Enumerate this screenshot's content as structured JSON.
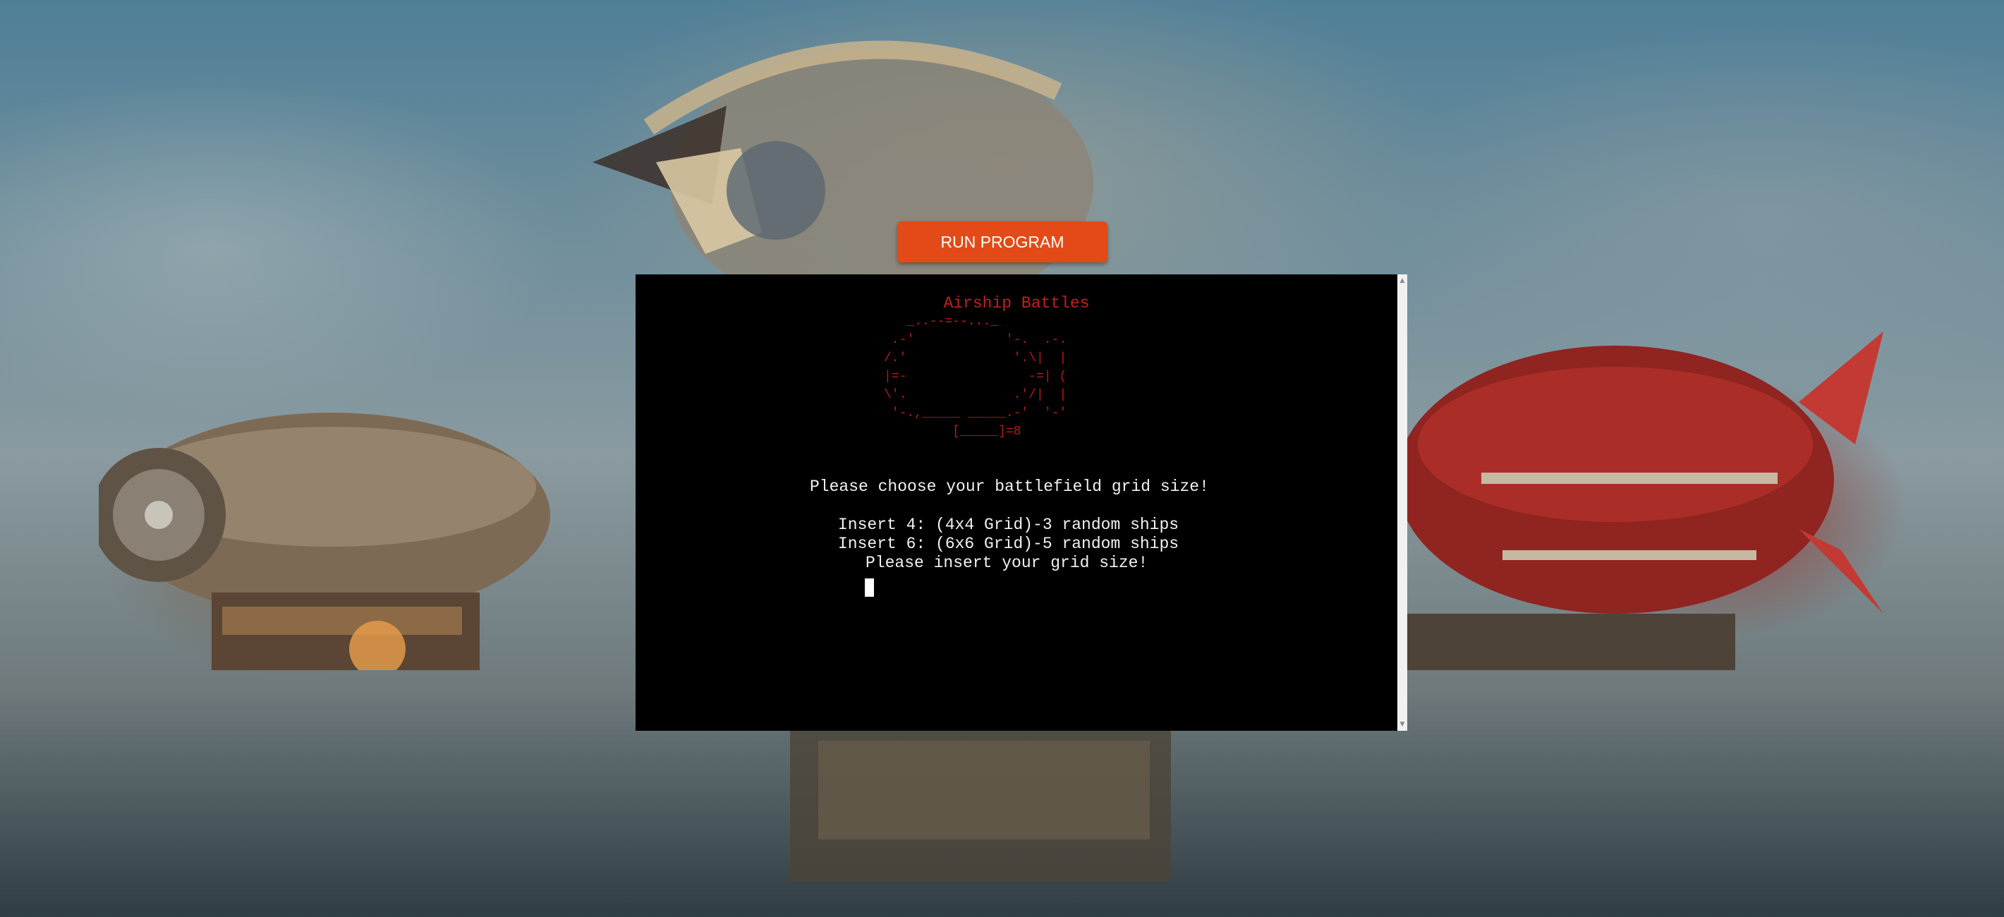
{
  "run_button": {
    "label": "RUN PROGRAM"
  },
  "terminal": {
    "title": "Airship Battles",
    "ascii_art": "   _..--=--..._\n .-'            '-.  .-.\n/.'              '.\\|  |\n|=-                -=| (\n\\'.              .'/|  |\n '-.,_____ _____.-'  '-'\n         [_____]=8",
    "lines": [
      "Please choose your battlefield grid size!",
      "Insert 4: (4x4 Grid)-3 random ships",
      "Insert 6: (6x6 Grid)-5 random ships",
      "Please insert your grid size!"
    ]
  },
  "scrollbar": {
    "up_arrow": "▲",
    "down_arrow": "▼"
  },
  "colors": {
    "button_bg": "#e34a17",
    "terminal_bg": "#000000",
    "title_red": "#c41e1e"
  }
}
